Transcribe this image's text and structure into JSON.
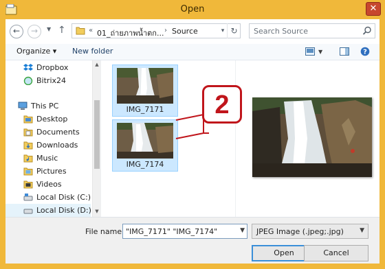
{
  "window": {
    "title": "Open",
    "close_glyph": "✕",
    "accent": "#f0b83a"
  },
  "address": {
    "overflow": "«",
    "crumbs": [
      "01_ถ่ายภาพน้ำตก...",
      "Source"
    ],
    "separator": "›",
    "dropdown_icon": "chevron-down-icon",
    "refresh_glyph": "↻"
  },
  "nav": {
    "back_glyph": "←",
    "forward_glyph": "→",
    "recent_glyph": "▼",
    "up_glyph": "↑"
  },
  "search": {
    "placeholder": "Search Source"
  },
  "toolbar": {
    "organize": "Organize ▾",
    "new_folder": "New folder",
    "help": "?"
  },
  "sidebar": {
    "items": [
      {
        "label": "Dropbox",
        "icon": "dropbox-icon"
      },
      {
        "label": "Bitrix24",
        "icon": "bitrix-icon"
      },
      {
        "label": "This PC",
        "icon": "computer-icon"
      },
      {
        "label": "Desktop",
        "icon": "folder-icon"
      },
      {
        "label": "Documents",
        "icon": "folder-icon"
      },
      {
        "label": "Downloads",
        "icon": "folder-icon"
      },
      {
        "label": "Music",
        "icon": "folder-icon"
      },
      {
        "label": "Pictures",
        "icon": "folder-icon"
      },
      {
        "label": "Videos",
        "icon": "folder-icon"
      },
      {
        "label": "Local Disk (C:)",
        "icon": "drive-icon"
      },
      {
        "label": "Local Disk (D:)",
        "icon": "drive-icon",
        "selected": true
      }
    ]
  },
  "files": [
    {
      "name": "IMG_7171",
      "selected": true
    },
    {
      "name": "IMG_7174",
      "selected": true
    }
  ],
  "callout": {
    "number": "2",
    "color": "#c0151b"
  },
  "footer": {
    "file_name_label": "File name:",
    "file_name_value": "\"IMG_7171\" \"IMG_7174\"",
    "file_type": "JPEG Image (.jpeg;.jpg)",
    "open_label": "Open",
    "cancel_label": "Cancel"
  }
}
